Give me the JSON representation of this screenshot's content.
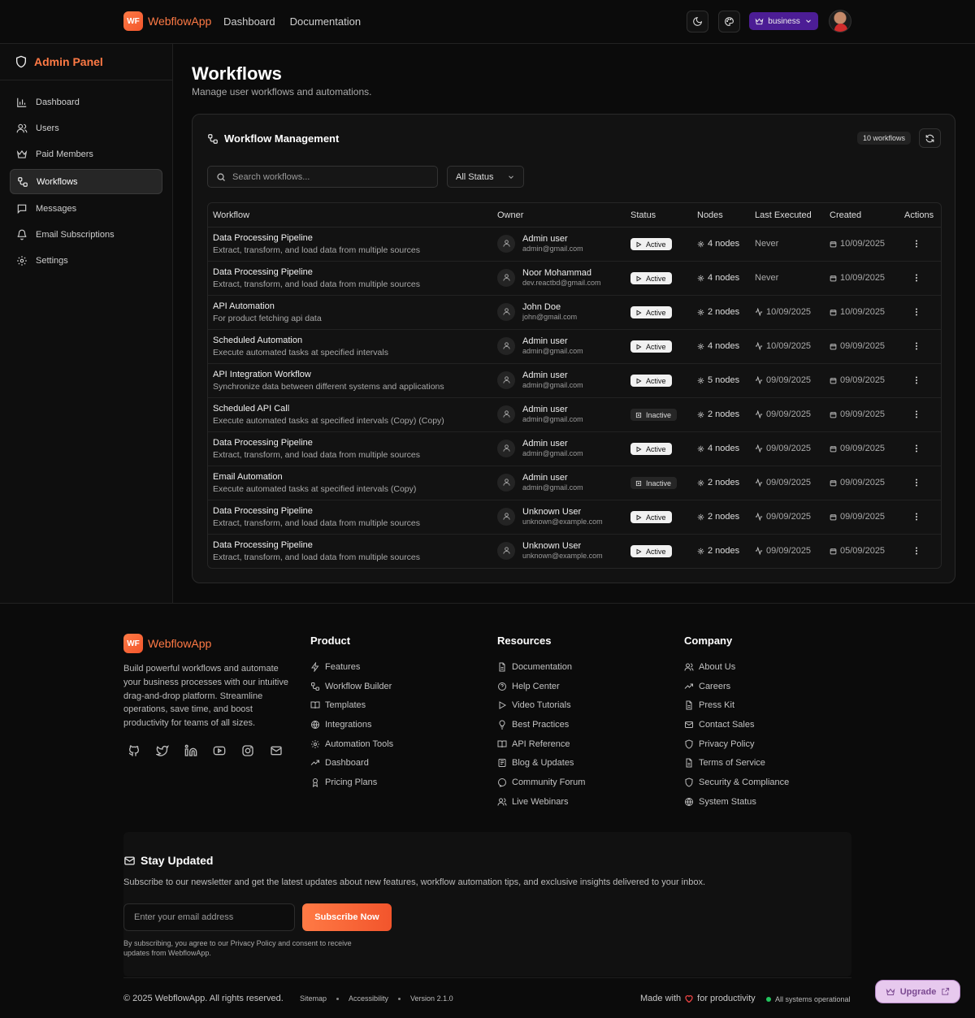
{
  "app": {
    "logo_text": "WF",
    "name": "WebflowApp",
    "nav": [
      "Dashboard",
      "Documentation"
    ],
    "plan_label": "business"
  },
  "sidebar": {
    "title": "Admin Panel",
    "items": [
      {
        "label": "Dashboard",
        "icon": "bar-chart-icon"
      },
      {
        "label": "Users",
        "icon": "users-icon"
      },
      {
        "label": "Paid Members",
        "icon": "crown-icon"
      },
      {
        "label": "Workflows",
        "icon": "workflow-icon",
        "active": true
      },
      {
        "label": "Messages",
        "icon": "message-icon"
      },
      {
        "label": "Email Subscriptions",
        "icon": "bell-icon"
      },
      {
        "label": "Settings",
        "icon": "gear-icon"
      }
    ]
  },
  "page": {
    "title": "Workflows",
    "subtitle": "Manage user workflows and automations."
  },
  "card": {
    "title": "Workflow Management",
    "count_badge": "10 workflows",
    "search_placeholder": "Search workflows...",
    "status_filter": "All Status"
  },
  "table": {
    "headers": [
      "Workflow",
      "Owner",
      "Status",
      "Nodes",
      "Last Executed",
      "Created",
      "Actions"
    ],
    "rows": [
      {
        "name": "Data Processing Pipeline",
        "desc": "Extract, transform, and load data from multiple sources",
        "owner": "Admin user",
        "email": "admin@gmail.com",
        "status": "Active",
        "nodes": "4 nodes",
        "last": "Never",
        "created": "10/09/2025"
      },
      {
        "name": "Data Processing Pipeline",
        "desc": "Extract, transform, and load data from multiple sources",
        "owner": "Noor Mohammad",
        "email": "dev.reactbd@gmail.com",
        "status": "Active",
        "nodes": "4 nodes",
        "last": "Never",
        "created": "10/09/2025"
      },
      {
        "name": "API Automation",
        "desc": "For product fetching api data",
        "owner": "John Doe",
        "email": "john@gmail.com",
        "status": "Active",
        "nodes": "2 nodes",
        "last": "10/09/2025",
        "created": "10/09/2025"
      },
      {
        "name": "Scheduled Automation",
        "desc": "Execute automated tasks at specified intervals",
        "owner": "Admin user",
        "email": "admin@gmail.com",
        "status": "Active",
        "nodes": "4 nodes",
        "last": "10/09/2025",
        "created": "09/09/2025"
      },
      {
        "name": "API Integration Workflow",
        "desc": "Synchronize data between different systems and applications",
        "owner": "Admin user",
        "email": "admin@gmail.com",
        "status": "Active",
        "nodes": "5 nodes",
        "last": "09/09/2025",
        "created": "09/09/2025"
      },
      {
        "name": "Scheduled API Call",
        "desc": "Execute automated tasks at specified intervals (Copy) (Copy)",
        "owner": "Admin user",
        "email": "admin@gmail.com",
        "status": "Inactive",
        "nodes": "2 nodes",
        "last": "09/09/2025",
        "created": "09/09/2025"
      },
      {
        "name": "Data Processing Pipeline",
        "desc": "Extract, transform, and load data from multiple sources",
        "owner": "Admin user",
        "email": "admin@gmail.com",
        "status": "Active",
        "nodes": "4 nodes",
        "last": "09/09/2025",
        "created": "09/09/2025"
      },
      {
        "name": "Email Automation",
        "desc": "Execute automated tasks at specified intervals (Copy)",
        "owner": "Admin user",
        "email": "admin@gmail.com",
        "status": "Inactive",
        "nodes": "2 nodes",
        "last": "09/09/2025",
        "created": "09/09/2025"
      },
      {
        "name": "Data Processing Pipeline",
        "desc": "Extract, transform, and load data from multiple sources",
        "owner": "Unknown User",
        "email": "unknown@example.com",
        "status": "Active",
        "nodes": "2 nodes",
        "last": "09/09/2025",
        "created": "09/09/2025"
      },
      {
        "name": "Data Processing Pipeline",
        "desc": "Extract, transform, and load data from multiple sources",
        "owner": "Unknown User",
        "email": "unknown@example.com",
        "status": "Active",
        "nodes": "2 nodes",
        "last": "09/09/2025",
        "created": "05/09/2025"
      }
    ]
  },
  "footer": {
    "brand": "WebflowApp",
    "description": "Build powerful workflows and automate your business processes with our intuitive drag-and-drop platform. Streamline operations, save time, and boost productivity for teams of all sizes.",
    "social": [
      "github-icon",
      "twitter-icon",
      "linkedin-icon",
      "youtube-icon",
      "instagram-icon",
      "mail-icon"
    ],
    "columns": [
      {
        "title": "Product",
        "links": [
          {
            "label": "Features",
            "icon": "zap-icon"
          },
          {
            "label": "Workflow Builder",
            "icon": "workflow-icon"
          },
          {
            "label": "Templates",
            "icon": "book-icon"
          },
          {
            "label": "Integrations",
            "icon": "globe-icon"
          },
          {
            "label": "Automation Tools",
            "icon": "gear-icon"
          },
          {
            "label": "Dashboard",
            "icon": "trend-icon"
          },
          {
            "label": "Pricing Plans",
            "icon": "award-icon"
          }
        ]
      },
      {
        "title": "Resources",
        "links": [
          {
            "label": "Documentation",
            "icon": "file-icon"
          },
          {
            "label": "Help Center",
            "icon": "help-icon"
          },
          {
            "label": "Video Tutorials",
            "icon": "play-icon"
          },
          {
            "label": "Best Practices",
            "icon": "bulb-icon"
          },
          {
            "label": "API Reference",
            "icon": "book-icon"
          },
          {
            "label": "Blog & Updates",
            "icon": "blog-icon"
          },
          {
            "label": "Community Forum",
            "icon": "message-icon"
          },
          {
            "label": "Live Webinars",
            "icon": "users-icon"
          }
        ]
      },
      {
        "title": "Company",
        "links": [
          {
            "label": "About Us",
            "icon": "users-icon"
          },
          {
            "label": "Careers",
            "icon": "trend-icon"
          },
          {
            "label": "Press Kit",
            "icon": "file-icon"
          },
          {
            "label": "Contact Sales",
            "icon": "mail-icon"
          },
          {
            "label": "Privacy Policy",
            "icon": "shield-icon"
          },
          {
            "label": "Terms of Service",
            "icon": "file-icon"
          },
          {
            "label": "Security & Compliance",
            "icon": "shield-icon"
          },
          {
            "label": "System Status",
            "icon": "globe-icon"
          }
        ]
      }
    ],
    "newsletter": {
      "title": "Stay Updated",
      "text": "Subscribe to our newsletter and get the latest updates about new features, workflow automation tips, and exclusive insights delivered to your inbox.",
      "placeholder": "Enter your email address",
      "button": "Subscribe Now",
      "legal": "By subscribing, you agree to our Privacy Policy and consent to receive updates from WebflowApp."
    },
    "copyright": "© 2025 WebflowApp. All rights reserved.",
    "bottom_links": [
      "Sitemap",
      "Accessibility",
      "Version 2.1.0"
    ],
    "made_prefix": "Made with",
    "made_suffix": "for productivity",
    "system_status": "All systems operational"
  },
  "upgrade_label": "Upgrade",
  "colors": {
    "accent": "#ff7a45",
    "plan": "#4c1d95",
    "ok": "#22c55e"
  }
}
